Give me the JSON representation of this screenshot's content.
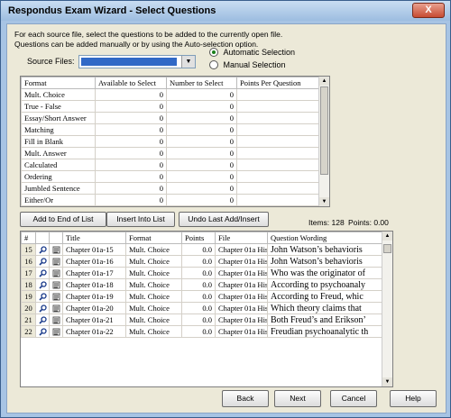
{
  "window": {
    "title": "Respondus Exam Wizard - Select Questions",
    "close_glyph": "X"
  },
  "instructions": "For each source file, select the questions to be added to the currently open file.  Questions can be added manually or by using the Auto-selection option.",
  "source": {
    "label": "Source Files:"
  },
  "selection_mode": {
    "automatic": "Automatic Selection",
    "manual": "Manual Selection",
    "selected": "automatic"
  },
  "format_table": {
    "headers": [
      "Format",
      "Available to Select",
      "Number to Select",
      "Points Per Question"
    ],
    "rows": [
      [
        "Mult. Choice",
        "0",
        "0",
        ""
      ],
      [
        "True - False",
        "0",
        "0",
        ""
      ],
      [
        "Essay/Short Answer",
        "0",
        "0",
        ""
      ],
      [
        "Matching",
        "0",
        "0",
        ""
      ],
      [
        "Fill in Blank",
        "0",
        "0",
        ""
      ],
      [
        "Mult. Answer",
        "0",
        "0",
        ""
      ],
      [
        "Calculated",
        "0",
        "0",
        ""
      ],
      [
        "Ordering",
        "0",
        "0",
        ""
      ],
      [
        "Jumbled Sentence",
        "0",
        "0",
        ""
      ],
      [
        "Either/Or",
        "0",
        "0",
        ""
      ]
    ]
  },
  "actions": {
    "add_end": "Add to End of List",
    "insert": "Insert Into List",
    "undo": "Undo Last Add/Insert"
  },
  "summary": {
    "items": "Items: 128",
    "points": "Points: 0.00"
  },
  "question_table": {
    "headers": [
      "#",
      "",
      "",
      "Title",
      "Format",
      "Points",
      "File",
      "Question Wording"
    ],
    "rows": [
      [
        "15",
        "Chapter 01a-15",
        "Mult. Choice",
        "0.0",
        "Chapter 01a His",
        "John Watson’s behavioris"
      ],
      [
        "16",
        "Chapter 01a-16",
        "Mult. Choice",
        "0.0",
        "Chapter 01a His",
        "John Watson’s behavioris"
      ],
      [
        "17",
        "Chapter 01a-17",
        "Mult. Choice",
        "0.0",
        "Chapter 01a His",
        "Who was the originator of"
      ],
      [
        "18",
        "Chapter 01a-18",
        "Mult. Choice",
        "0.0",
        "Chapter 01a His",
        "According to psychoanaly"
      ],
      [
        "19",
        "Chapter 01a-19",
        "Mult. Choice",
        "0.0",
        "Chapter 01a His",
        "According to Freud, whic"
      ],
      [
        "20",
        "Chapter 01a-20",
        "Mult. Choice",
        "0.0",
        "Chapter 01a His",
        "Which theory claims that"
      ],
      [
        "21",
        "Chapter 01a-21",
        "Mult. Choice",
        "0.0",
        "Chapter 01a His",
        "Both Freud’s and Erikson’"
      ],
      [
        "22",
        "Chapter 01a-22",
        "Mult. Choice",
        "0.0",
        "Chapter 01a His",
        "Freudian psychoanalytic th"
      ]
    ]
  },
  "nav": {
    "back": "Back",
    "next": "Next",
    "cancel": "Cancel",
    "help": "Help"
  },
  "colors": {
    "accent": "#3169c6",
    "title_bar": "#9dbde0"
  }
}
